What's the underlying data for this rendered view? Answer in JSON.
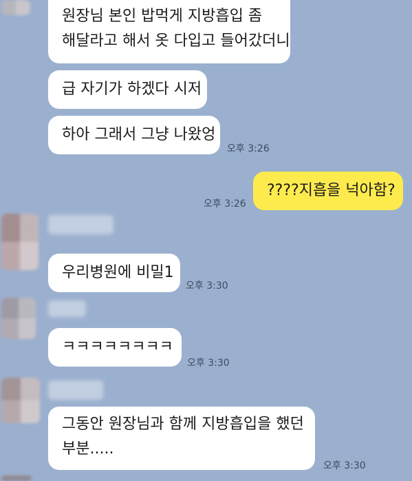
{
  "messages": [
    {
      "lines": [
        "원장님 본인 밥먹게 지방흡입 좀",
        "해달라고 해서 옷 다입고 들어갔더니"
      ]
    },
    {
      "text": "급 자기가 하겠다 시저"
    },
    {
      "text": "하아 그래서 그냥 나왔엉",
      "time": "오후 3:26"
    },
    {
      "text": "????지흡을 넉아함?",
      "time": "오후 3:26"
    },
    {
      "text": "우리병원에 비밀1",
      "time": "오후 3:30"
    },
    {
      "text": "ㅋㅋㅋㅋㅋㅋㅋㅋ",
      "time": "오후 3:30"
    },
    {
      "lines": [
        "그동안 원장님과 함께 지방흡입을 했던",
        "부분....."
      ],
      "time": "오후 3:30"
    }
  ],
  "colors": {
    "background": "#9bb0cf",
    "incoming_bubble": "#ffffff",
    "outgoing_bubble": "#fdeb4e"
  }
}
